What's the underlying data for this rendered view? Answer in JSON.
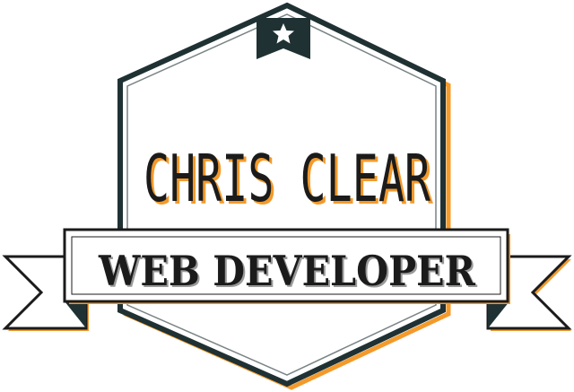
{
  "badge": {
    "name": "CHRIS CLEAR",
    "title": "WEB DEVELOPER",
    "top_icon": "star-icon",
    "colors": {
      "dark": "#1f3133",
      "orange": "#f39a2b",
      "white": "#ffffff",
      "text": "#1b1b1b"
    }
  }
}
